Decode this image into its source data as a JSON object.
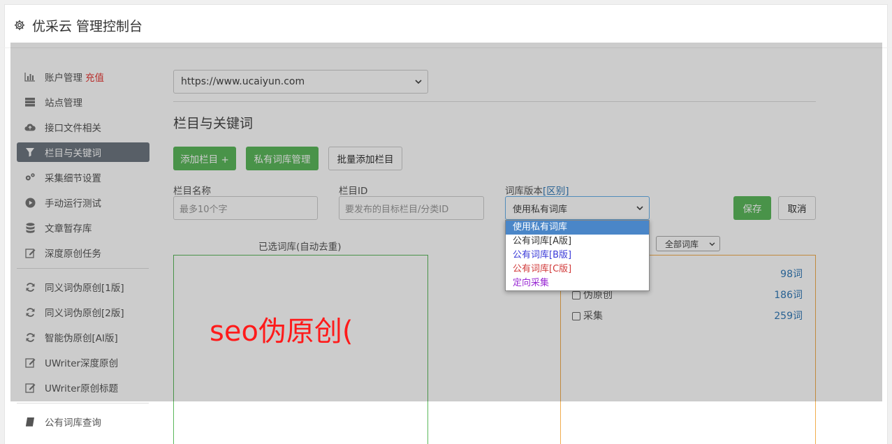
{
  "app": {
    "title": "优采云 管理控制台"
  },
  "sidebar": {
    "items": [
      {
        "label": "账户管理",
        "extra": "充值",
        "icon": "bar-chart-icon"
      },
      {
        "label": "站点管理",
        "icon": "server-icon"
      },
      {
        "label": "接口文件相关",
        "icon": "cloud-upload-icon"
      },
      {
        "label": "栏目与关键词",
        "icon": "filter-icon",
        "active": true
      },
      {
        "label": "采集细节设置",
        "icon": "gears-icon"
      },
      {
        "label": "手动运行测试",
        "icon": "play-circle-icon"
      },
      {
        "label": "文章暂存库",
        "icon": "database-icon"
      },
      {
        "label": "深度原创任务",
        "icon": "edit-icon"
      }
    ],
    "items2": [
      {
        "label": "同义词伪原创[1版]",
        "icon": "refresh-icon"
      },
      {
        "label": "同义词伪原创[2版]",
        "icon": "refresh-icon"
      },
      {
        "label": "智能伪原创[AI版]",
        "icon": "refresh-icon"
      },
      {
        "label": "UWriter深度原创",
        "icon": "edit-icon"
      },
      {
        "label": "UWriter原创标题",
        "icon": "edit-icon"
      }
    ],
    "items3": [
      {
        "label": "公有词库查询",
        "icon": "book-icon"
      }
    ]
  },
  "main": {
    "site_select": "https://www.ucaiyun.com",
    "section_title": "栏目与关键词",
    "buttons": {
      "add_column": "添加栏目 +",
      "private_lib": "私有词库管理",
      "batch_add": "批量添加栏目",
      "save": "保存",
      "cancel": "取消"
    },
    "form": {
      "name_label": "栏目名称",
      "name_placeholder": "最多10个字",
      "id_label": "栏目ID",
      "id_placeholder": "要发布的目标栏目/分类ID",
      "lib_label": "词库版本",
      "lib_link": "[区别]",
      "lib_selected": "使用私有词库"
    },
    "dropdown_options": [
      {
        "label": "使用私有词库",
        "color": "#ffffff",
        "selected": true
      },
      {
        "label": "公有词库[A版]",
        "color": "#333333"
      },
      {
        "label": "公有词库[B版]",
        "color": "#3a3ad8"
      },
      {
        "label": "公有词库[C版]",
        "color": "#d13a3a"
      },
      {
        "label": "定向采集",
        "color": "#9a2bd4"
      }
    ],
    "selected_box_caption": "已选词库(自动去重)",
    "all_lib_select": "全部词库",
    "libs": [
      {
        "label": "",
        "count": "98词"
      },
      {
        "label": "伪原创",
        "count": "186词"
      },
      {
        "label": "采集",
        "count": "259词"
      }
    ],
    "overlay_text": "seo伪原创("
  },
  "colors": {
    "accent_green": "#5cb85c",
    "link_blue": "#337ab7",
    "active_gray": "#6f7781",
    "red": "#ff1a1a"
  }
}
